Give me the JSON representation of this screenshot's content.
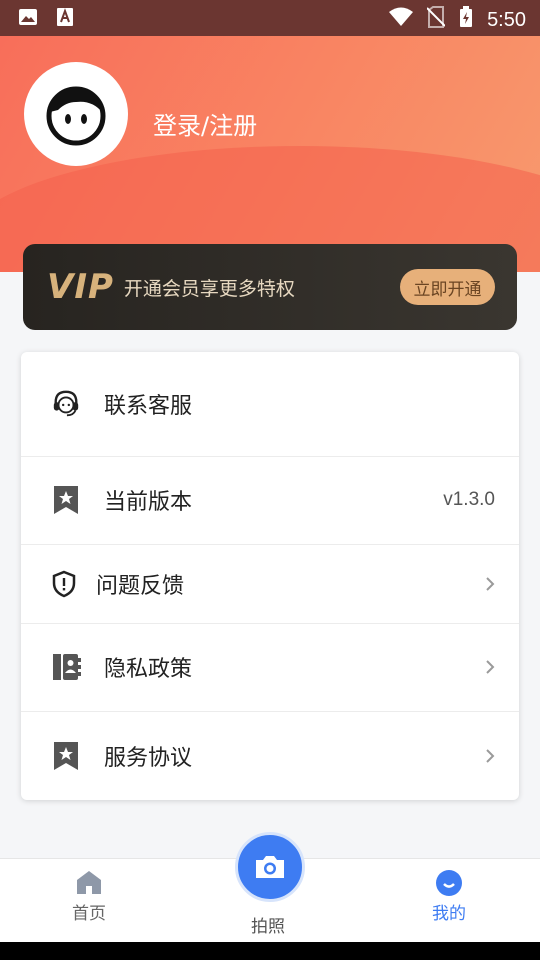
{
  "status_bar": {
    "time": "5:50"
  },
  "profile": {
    "login_text": "登录/注册"
  },
  "vip_banner": {
    "logo": "VIP",
    "text": "开通会员享更多特权",
    "button": "立即开通"
  },
  "menu": [
    {
      "label": "联系客服",
      "icon": "headset-icon"
    },
    {
      "label": "当前版本",
      "icon": "bookmark-star-icon",
      "value": "v1.3.0"
    },
    {
      "label": "问题反馈",
      "icon": "shield-alert-icon"
    },
    {
      "label": "隐私政策",
      "icon": "contacts-book-icon"
    },
    {
      "label": "服务协议",
      "icon": "bookmark-star-icon"
    }
  ],
  "nav": {
    "home": "首页",
    "camera": "拍照",
    "mine": "我的",
    "active": "mine",
    "accent": "#3e7cf2"
  }
}
